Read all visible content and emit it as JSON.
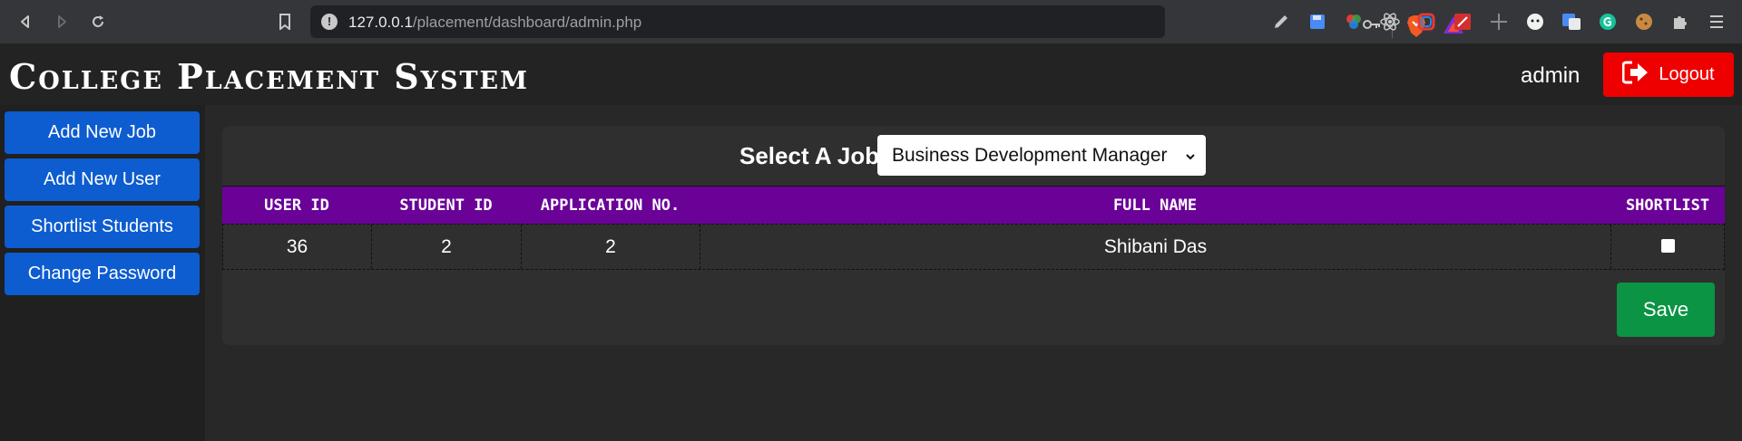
{
  "browser": {
    "url_host": "127.0.0.1",
    "url_path": "/placement/dashboard/admin.php",
    "extensions": [
      "pencil-icon",
      "save-icon",
      "color-picker-icon",
      "react-icon",
      "chromatic-icon",
      "toolbox-icon",
      "move-icon",
      "face-icon",
      "translate-icon",
      "grammarly-icon",
      "cookie-icon",
      "puzzle-icon",
      "menu-icon"
    ]
  },
  "header": {
    "title": "College Placement System",
    "username": "admin",
    "logout_label": "Logout"
  },
  "sidebar": {
    "items": [
      {
        "label": "Add New Job"
      },
      {
        "label": "Add New User"
      },
      {
        "label": "Shortlist Students"
      },
      {
        "label": "Change Password"
      }
    ]
  },
  "main": {
    "job_label": "Select A Job",
    "job_selected": "Business Development Manager",
    "columns": [
      "USER ID",
      "STUDENT ID",
      "APPLICATION NO.",
      "FULL NAME",
      "SHORTLIST"
    ],
    "rows": [
      {
        "user_id": "36",
        "student_id": "2",
        "application_no": "2",
        "full_name": "Shibani Das",
        "shortlisted": false
      }
    ],
    "save_label": "Save"
  },
  "colors": {
    "accent_blue": "#0d5cd0",
    "table_header": "#6a0298",
    "logout_red": "#ee0000",
    "save_green": "#0b9444"
  }
}
